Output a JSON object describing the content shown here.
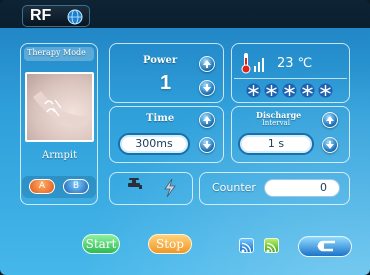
{
  "header": {
    "logo_text": "RF"
  },
  "therapy": {
    "title": "Therapy Mode",
    "area_label": "Armpit",
    "mode_a": "A",
    "mode_b": "B"
  },
  "power": {
    "title": "Power",
    "value": "1"
  },
  "time": {
    "title": "Time",
    "value": "300ms"
  },
  "temperature": {
    "value": "23 ℃"
  },
  "discharge": {
    "title_line1": "Discharge",
    "title_line2": "Interval",
    "value": "1 s"
  },
  "counter": {
    "label": "Counter",
    "value": "0"
  },
  "footer": {
    "start_label": "Start",
    "stop_label": "Stop"
  },
  "colors": {
    "start": "#44d06a",
    "stop": "#f0a02a",
    "accent": "#1f82c2"
  }
}
